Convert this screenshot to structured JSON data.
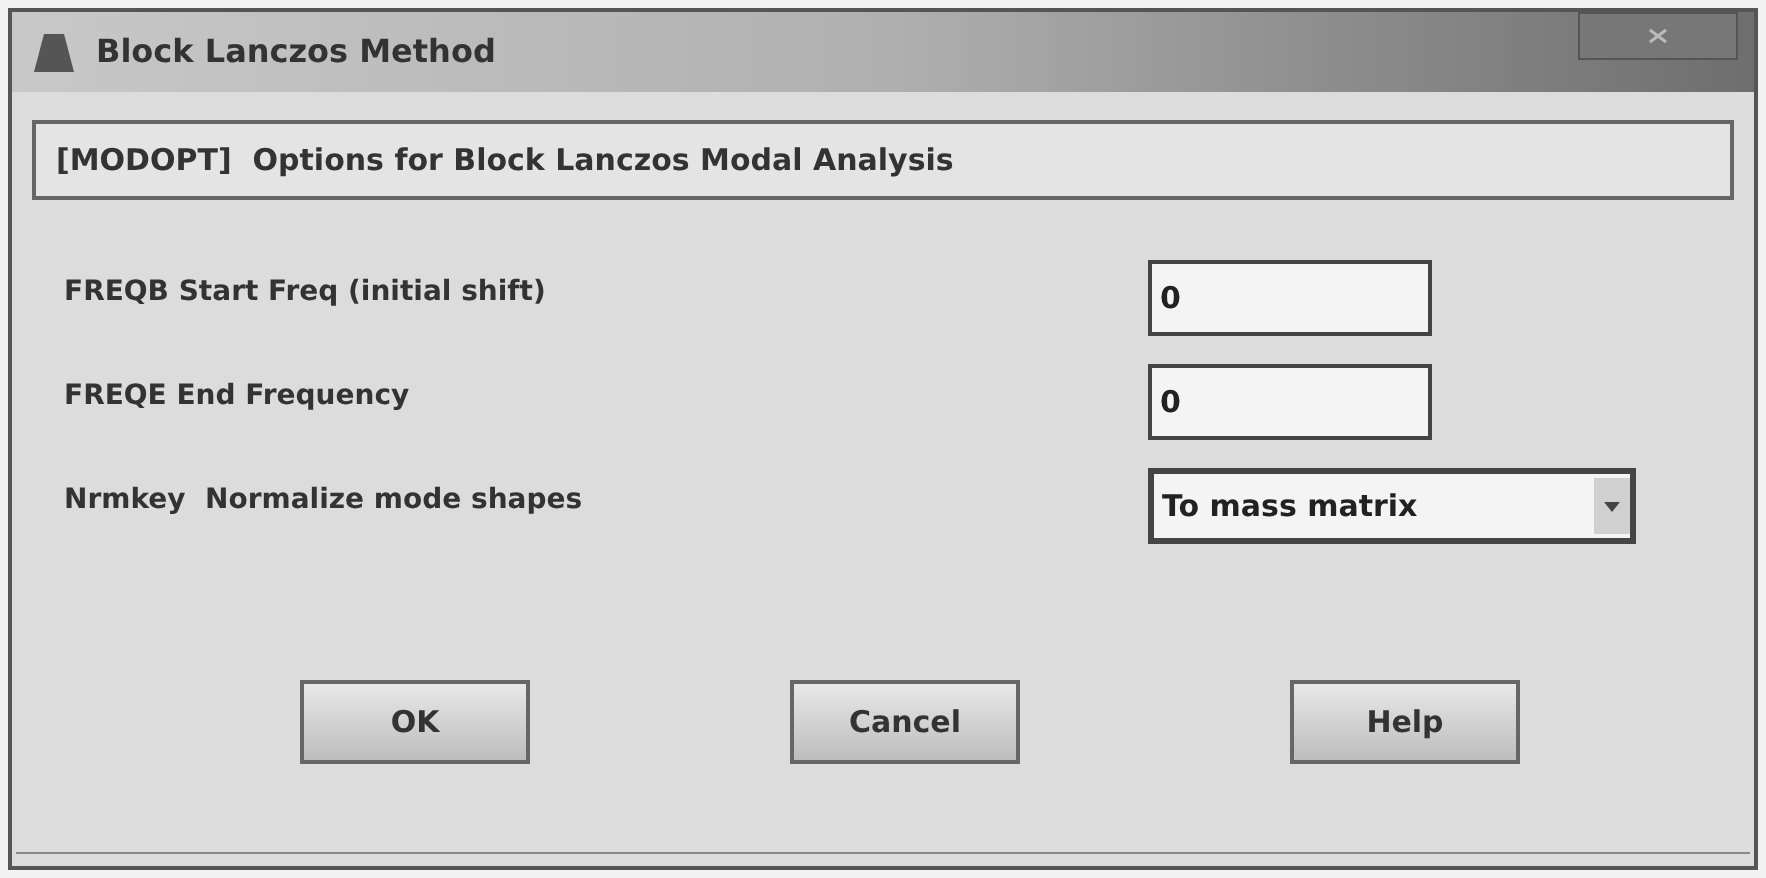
{
  "window": {
    "title": "Block Lanczos Method"
  },
  "header": "[MODOPT]  Options for Block Lanczos Modal Analysis",
  "fields": [
    {
      "kind": "text",
      "label": "FREQB Start Freq (initial shift)",
      "value": "0"
    },
    {
      "kind": "text",
      "label": "FREQE End Frequency",
      "value": "0"
    },
    {
      "kind": "dropdown",
      "label": "Nrmkey  Normalize mode shapes",
      "value": "To mass matrix"
    }
  ],
  "buttons": [
    "OK",
    "Cancel",
    "Help"
  ]
}
